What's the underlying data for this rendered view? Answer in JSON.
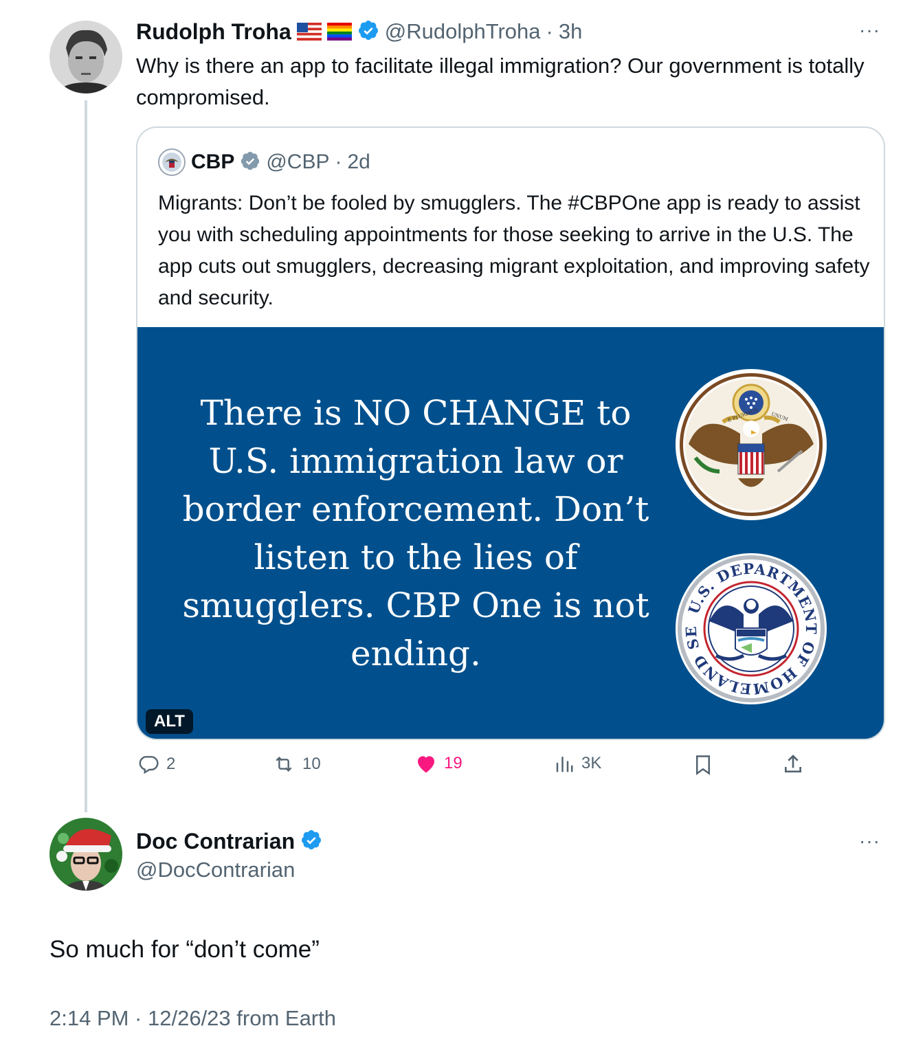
{
  "tweet": {
    "author_name": "Rudolph Troha",
    "flags": [
      "us-flag",
      "rainbow-flag"
    ],
    "handle": "@RudolphTroha",
    "separator": "·",
    "time": "3h",
    "text": "Why is there an app to facilitate illegal immigration? Our government is totally compromised.",
    "more_label": "···"
  },
  "quote": {
    "author_name": "CBP",
    "handle": "@CBP",
    "separator": "·",
    "time": "2d",
    "text": "Migrants: Don’t be fooled by smugglers. The #CBPOne app is ready to assist you with scheduling appointments for those seeking to arrive in the U.S. The app cuts out smugglers, decreasing migrant exploitation, and improving safety and security.",
    "image_text": "There is NO CHANGE to U.S. immigration law or border enforcement. Don’t listen to the lies of smugglers. CBP One is not ending.",
    "image_bg": "#01508d",
    "alt_label": "ALT",
    "seal_top": {
      "banner_left": "E PLURIBUS",
      "banner_right": "UNUM"
    },
    "seal_bottom": {
      "ring_text": "U.S. DEPARTMENT OF HOMELAND SECURITY"
    }
  },
  "actions": {
    "replies": "2",
    "reposts": "10",
    "likes": "19",
    "views": "3K",
    "like_color": "#f91880"
  },
  "reply": {
    "author_name": "Doc Contrarian",
    "handle": "@DocContrarian",
    "more_label": "···",
    "text": "So much for “don’t come”",
    "timestamp": "2:14 PM · 12/26/23 from Earth"
  },
  "colors": {
    "verified": "#1d9bf0",
    "gray_verified": "#829aab",
    "muted": "#536471"
  }
}
